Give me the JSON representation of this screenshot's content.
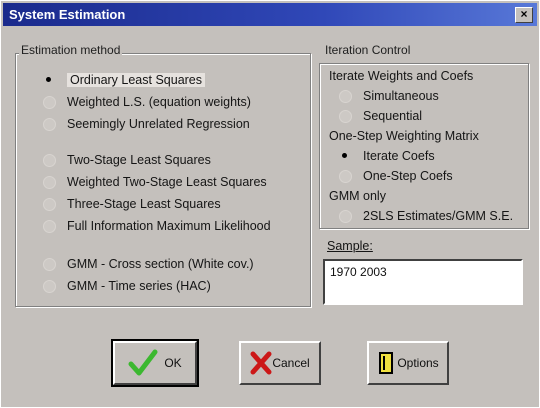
{
  "window": {
    "title": "System Estimation",
    "close_glyph": "×"
  },
  "estimation_method": {
    "label": "Estimation method",
    "options": [
      "Ordinary Least Squares",
      "Weighted L.S.  (equation weights)",
      "Seemingly Unrelated Regression",
      "Two-Stage Least Squares",
      "Weighted Two-Stage Least Squares",
      "Three-Stage Least Squares",
      "Full Information Maximum Likelihood",
      "GMM - Cross section (White cov.)",
      "GMM - Time series    (HAC)"
    ],
    "selected": "Ordinary Least Squares"
  },
  "iteration_control": {
    "label": "Iteration Control",
    "iterate_heading": "Iterate Weights and Coefs",
    "iterate_options": [
      "Simultaneous",
      "Sequential"
    ],
    "onestep_heading": "One-Step Weighting Matrix",
    "onestep_options": [
      "Iterate Coefs",
      "One-Step Coefs"
    ],
    "onestep_selected": "Iterate Coefs",
    "gmm_heading": "GMM only",
    "gmm_options": [
      "2SLS Estimates/GMM S.E."
    ]
  },
  "sample": {
    "label": "Sample:",
    "value": "1970 2003"
  },
  "buttons": {
    "ok": "OK",
    "cancel": "Cancel",
    "options": "Options"
  },
  "colors": {
    "titlebar": "#1a2a8c",
    "dialog_bg": "#c4c0bc",
    "ok_check": "#3cb830",
    "cancel_x": "#cc1818"
  }
}
